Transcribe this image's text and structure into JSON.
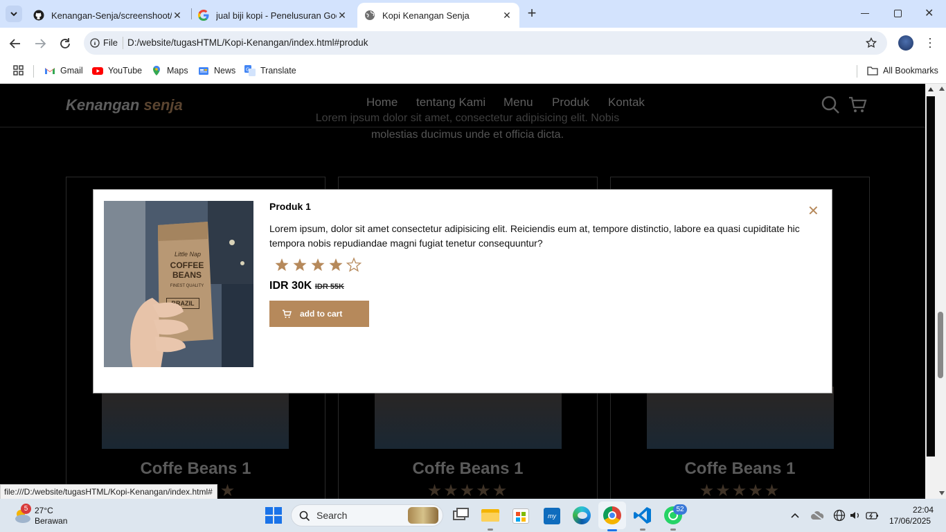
{
  "browser": {
    "tabs": [
      {
        "title": "Kenangan-Senja/screenshoot/h",
        "active": false,
        "icon": "github-icon"
      },
      {
        "title": "jual biji kopi - Penelusuran Goo",
        "active": false,
        "icon": "google-icon"
      },
      {
        "title": "Kopi Kenangan Senja",
        "active": true,
        "icon": "globe-icon"
      }
    ],
    "new_tab": "+",
    "address": {
      "scheme_label": "File",
      "url": "D:/website/tugasHTML/Kopi-Kenangan/index.html#produk"
    },
    "bookmarks": [
      {
        "label": "Gmail",
        "icon": "gmail-icon"
      },
      {
        "label": "YouTube",
        "icon": "youtube-icon"
      },
      {
        "label": "Maps",
        "icon": "maps-icon"
      },
      {
        "label": "News",
        "icon": "news-icon"
      },
      {
        "label": "Translate",
        "icon": "translate-icon"
      }
    ],
    "all_bookmarks": "All Bookmarks",
    "status_url": "file:///D:/website/tugasHTML/Kopi-Kenangan/index.html#"
  },
  "site": {
    "logo_main": "Kenangan",
    "logo_accent": " senja",
    "nav": [
      "Home",
      "tentang Kami",
      "Menu",
      "Produk",
      "Kontak"
    ],
    "intro_line1": "Lorem ipsum dolor sit amet, consectetur adipisicing elit. Nobis",
    "intro_line2": "molestias ducimus unde et officia dicta.",
    "cards": [
      {
        "name": "Coffe Beans 1"
      },
      {
        "name": "Coffe Beans 1"
      },
      {
        "name": "Coffe Beans 1"
      }
    ],
    "card_stars": "★★★★★"
  },
  "modal": {
    "title": "Produk 1",
    "description": "Lorem ipsum, dolor sit amet consectetur adipisicing elit. Reiciendis eum at, tempore distinctio, labore ea quasi cupiditate hic tempora nobis repudiandae magni fugiat tenetur consequuntur?",
    "rating": 4,
    "rating_max": 5,
    "price": "IDR 30K",
    "old_price": "IDR 55K",
    "cart_button": "add to cart",
    "close": "✕",
    "accent_color": "#b6895b",
    "product_image_text": [
      "Little Nap",
      "COFFEE",
      "BEANS",
      "FINEST QUALITY",
      "BRAZIL"
    ]
  },
  "taskbar": {
    "weather_temp": "27°C",
    "weather_desc": "Berawan",
    "weather_badge": "5",
    "search_label": "Search",
    "whatsapp_badge": "52",
    "time": "22:04",
    "date": "17/06/2025"
  }
}
